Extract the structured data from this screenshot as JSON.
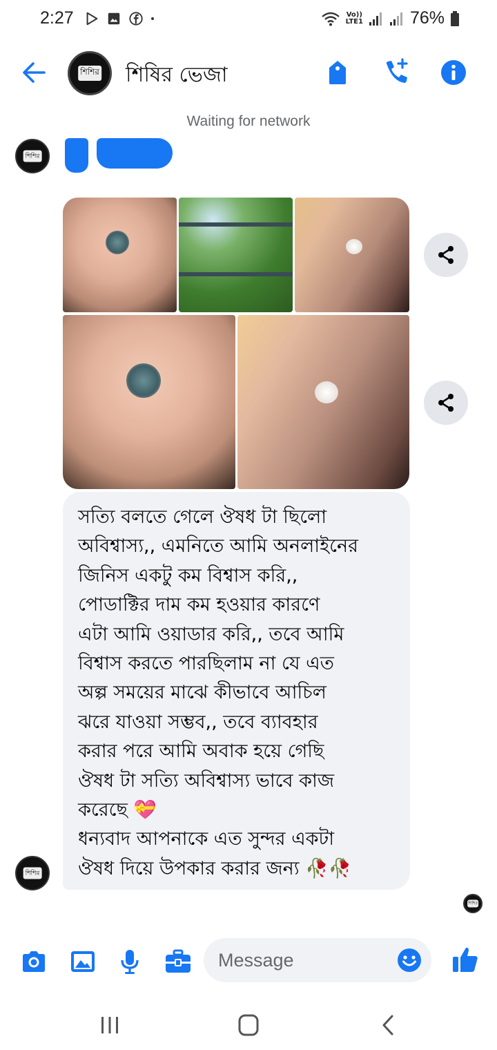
{
  "status_bar": {
    "time": "2:27",
    "battery": "76%",
    "network_label_top": "Vo))",
    "network_label_bottom": "LTE1"
  },
  "header": {
    "contact_name": "শিষির ভেজা",
    "avatar_text": "শিশির"
  },
  "network_status": "Waiting for network",
  "message": {
    "text": "সত্যি বলতে গেলে ঔষধ টা ছিলো\nঅবিশ্বাস্য,, এমনিতে আমি অনলাইনের\nজিনিস একটু কম বিশ্বাস করি,,\nপোডাক্টির দাম কম হওয়ার কারণে\nএটা আমি ওয়াডার করি,, তবে আমি\nবিশ্বাস করতে পারছিলাম না যে এত\nঅল্প সময়ের মাঝে কীভাবে আচিল\nঝরে যাওয়া সম্ভব,, তবে ব্যাবহার\nকরার পরে আমি অবাক হয়ে গেছি\nঔষধ টা সত্যি অবিশ্বাস্য ভাবে কাজ\nকরেছে 💝\nধন্যবাদ আপনাকে এত সুন্দর একটা\nঔষধ দিয়ে উপকার করার জন্য 🥀🥀"
  },
  "composer": {
    "placeholder": "Message"
  },
  "icons": {
    "accent": "#1877f2",
    "back": "arrow-left-icon",
    "tag": "tag-icon",
    "call": "add-call-icon",
    "info": "info-icon",
    "camera": "camera-icon",
    "gallery": "image-icon",
    "mic": "mic-icon",
    "briefcase": "briefcase-icon",
    "emoji": "emoji-icon",
    "like": "thumbs-up-icon",
    "share": "share-icon"
  }
}
